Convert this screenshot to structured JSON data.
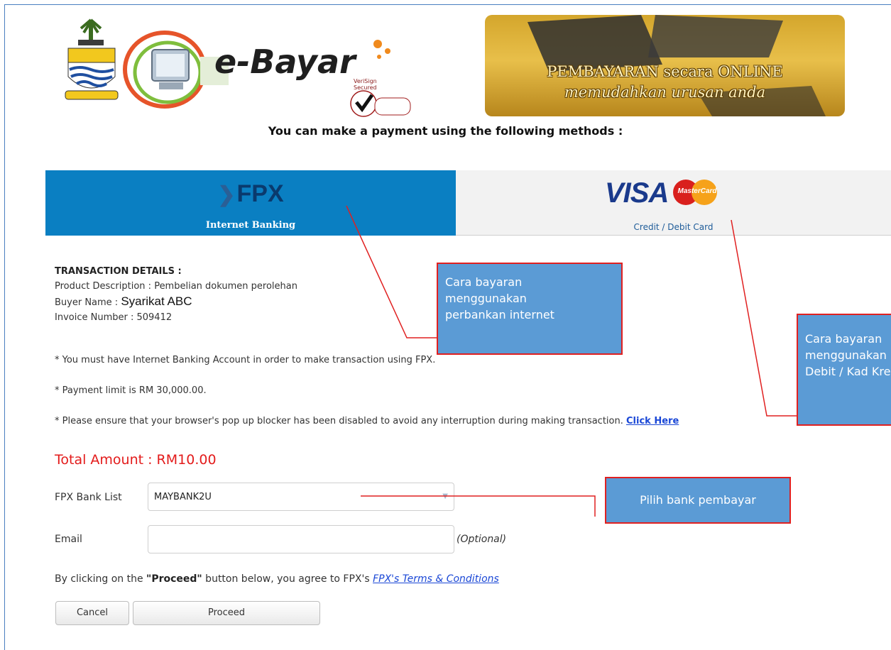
{
  "header": {
    "logo_text": "e-Bayar",
    "verisign_text": "VeriSign Secured",
    "banner_line1": "PEMBAYARAN secara ONLINE",
    "banner_line2": "memudahkan urusan anda"
  },
  "methods_title": "You can make a payment using the following methods :",
  "tabs": [
    {
      "logo": "FPX",
      "label": "Internet Banking",
      "active": true
    },
    {
      "logo": "VISA",
      "logo2": "MasterCard",
      "label": "Credit / Debit Card",
      "active": false
    }
  ],
  "details": {
    "heading": "TRANSACTION DETAILS :",
    "product_label": "Product Description : ",
    "product_value": "Pembelian dokumen perolehan",
    "buyer_label": "Buyer Name : ",
    "buyer_value": "Syarikat ABC",
    "invoice_label": "Invoice Number : ",
    "invoice_value": "509412"
  },
  "notes": [
    "* You must have Internet Banking Account in order to make transaction using FPX.",
    "* Payment limit is RM 30,000.00.",
    "* Please ensure that your browser's pop up blocker has been disabled to avoid any interruption during making transaction. "
  ],
  "click_here": "Click Here",
  "total": "Total Amount : RM10.00",
  "form": {
    "bank_label": "FPX Bank List",
    "bank_selected": "MAYBANK2U",
    "email_label": "Email",
    "email_value": "",
    "optional": "(Optional)"
  },
  "agree": {
    "prefix": "By clicking on the ",
    "proceed_word": "\"Proceed\"",
    "middle": " button below, you agree to FPX's ",
    "terms_link": "FPX's Terms & Conditions"
  },
  "buttons": {
    "cancel": "Cancel",
    "proceed": "Proceed"
  },
  "callouts": {
    "fpx": [
      "Cara bayaran",
      "menggunakan",
      "perbankan internet"
    ],
    "card": [
      "Cara bayaran",
      "menggunakan Kad",
      "Debit / Kad Kredit"
    ],
    "bank": "Pilih bank pembayar"
  },
  "colors": {
    "fpx_tab": "#0a7fc2",
    "callout_fill": "#5b9bd5",
    "callout_border": "#e02020",
    "total_red": "#e31b1b",
    "link_blue": "#1a47d6"
  }
}
